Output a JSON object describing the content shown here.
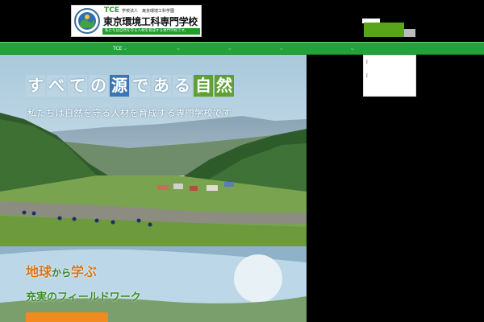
{
  "header": {
    "logo": {
      "abbr": "TCE",
      "corp": "学校法人　東京環境工科学園",
      "name": "東京環境工科専門学校",
      "tagline": "私たちは自然を守る人材を育成する専門学校です。"
    },
    "top_links": [
      "",
      "",
      "",
      ""
    ]
  },
  "nav": {
    "items": [
      {
        "label": "TCE",
        "has_dropdown": true
      },
      {
        "label": "",
        "has_dropdown": true
      },
      {
        "label": "",
        "has_dropdown": true
      },
      {
        "label": "",
        "has_dropdown": true
      },
      {
        "label": "",
        "has_dropdown": true
      }
    ],
    "dropdown": {
      "items": [
        "|",
        "|",
        ""
      ]
    }
  },
  "hero": {
    "title_chars": [
      "す",
      "べ",
      "て",
      "の",
      "源",
      "で",
      "あ",
      "る",
      "自",
      "然"
    ],
    "subtitle": "私たちは自然を守る人材を育成する専門学校です"
  },
  "hero2": {
    "title_a": "地球",
    "title_b": "から",
    "title_c": "学ぶ",
    "subtitle": "充実のフィールドワーク",
    "button_label": ""
  },
  "colors": {
    "nav_green": "#23a23a",
    "logo_green": "#1f9f2a",
    "accent_orange": "#ef8b1f",
    "title_green": "#5fa034",
    "title_blue": "#3a76b5"
  }
}
